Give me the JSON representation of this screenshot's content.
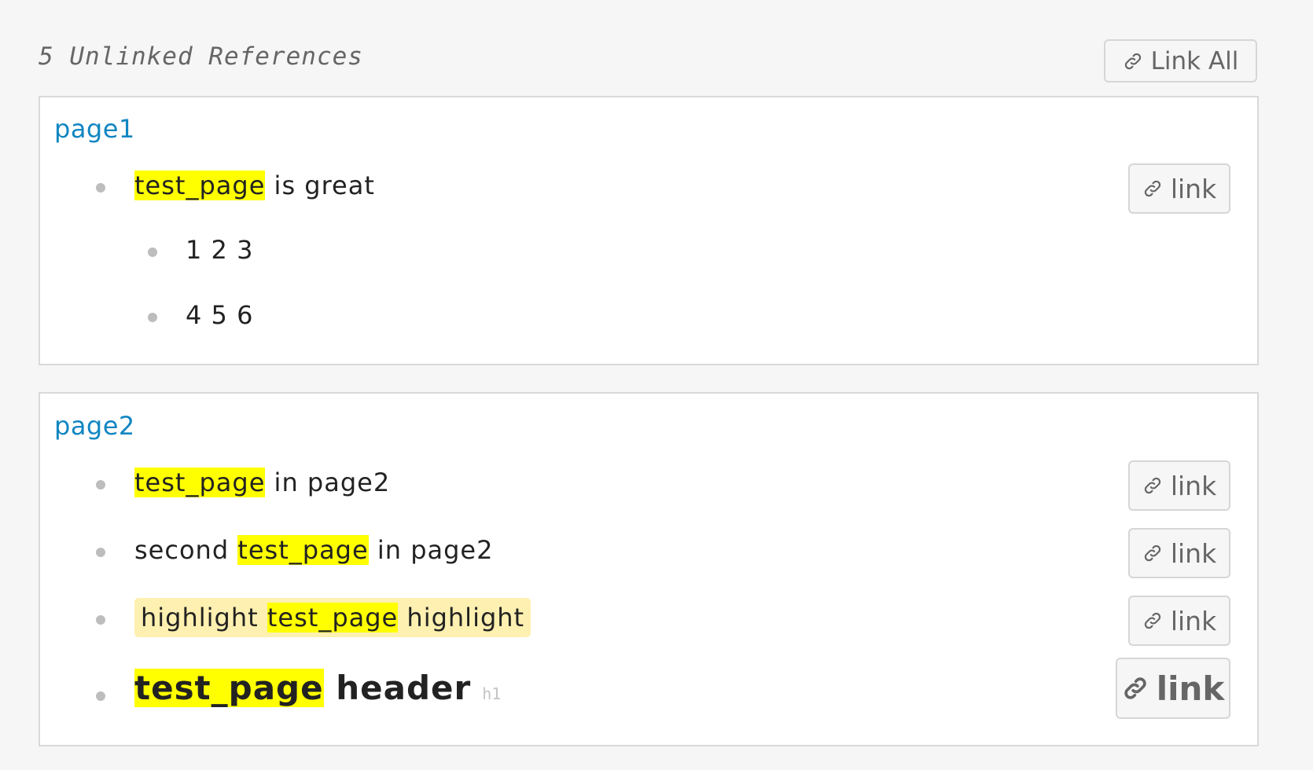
{
  "header": {
    "title": "5 Unlinked References",
    "link_all_label": "Link All"
  },
  "cards": [
    {
      "page": "page1",
      "blocks": [
        {
          "highlight": "test_page",
          "after": " is great",
          "button": "link"
        },
        {
          "text": "1 2 3"
        },
        {
          "text": "4 5 6"
        }
      ]
    },
    {
      "page": "page2",
      "blocks": [
        {
          "highlight": "test_page",
          "after": " in page2",
          "button": "link"
        },
        {
          "before": "second ",
          "highlight": "test_page",
          "after": " in page2",
          "button": "link"
        },
        {
          "before": "highlight ",
          "highlight": "test_page",
          "after": " highlight",
          "button": "link"
        },
        {
          "highlight": "test_page",
          "after": " header",
          "tag": "h1",
          "button": "link"
        }
      ]
    }
  ],
  "icons": {
    "link": "link-icon"
  },
  "colors": {
    "page_link": "#1186c1",
    "highlight": "#ffff00",
    "soft_highlight": "#fdf0b0",
    "border": "#d9d9d9"
  }
}
